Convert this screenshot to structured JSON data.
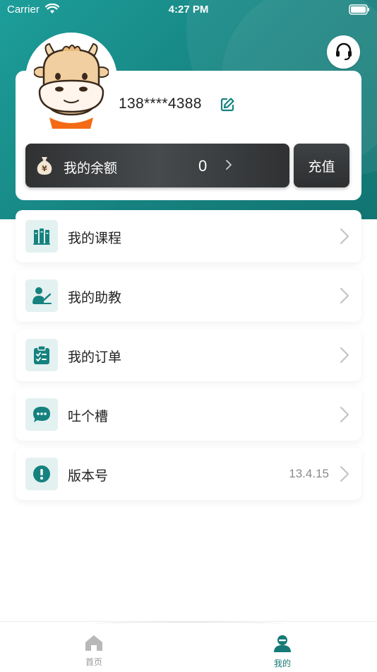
{
  "status_bar": {
    "carrier": "Carrier",
    "time": "4:27 PM"
  },
  "profile": {
    "phone": "138****4388"
  },
  "balance": {
    "label": "我的余额",
    "value": "0",
    "recharge_label": "充值"
  },
  "menu": [
    {
      "label": "我的课程",
      "icon": "books-icon",
      "value": ""
    },
    {
      "label": "我的助教",
      "icon": "teacher-icon",
      "value": ""
    },
    {
      "label": "我的订单",
      "icon": "clipboard-checklist-icon",
      "value": ""
    },
    {
      "label": "吐个槽",
      "icon": "chat-bubble-icon",
      "value": ""
    },
    {
      "label": "版本号",
      "icon": "info-alert-icon",
      "value": "13.4.15"
    }
  ],
  "tabs": [
    {
      "label": "首页",
      "icon": "home-icon",
      "active": false
    },
    {
      "label": "我的",
      "icon": "user-icon",
      "active": true
    }
  ],
  "colors": {
    "brand_teal": "#16827f",
    "icon_bg": "#e3f1f0",
    "balance_bg": "#3a3c3e",
    "tab_active": "#147a76",
    "tab_inactive": "#999999"
  }
}
